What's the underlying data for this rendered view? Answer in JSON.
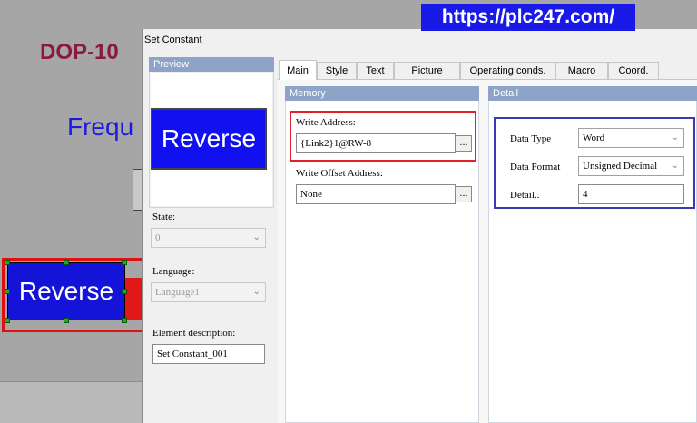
{
  "watermark": {
    "url": "https://plc247.com/"
  },
  "canvas": {
    "title": "DOP-10",
    "frequency_label": "Frequ",
    "button_label": "Reverse"
  },
  "dialog": {
    "title": "Set Constant",
    "preview": {
      "header": "Preview",
      "button_label": "Reverse"
    },
    "state": {
      "label": "State:",
      "value": "0"
    },
    "language": {
      "label": "Language:",
      "value": "Language1"
    },
    "element_description": {
      "label": "Element description:",
      "value": "Set Constant_001"
    },
    "tabs": [
      {
        "label": "Main"
      },
      {
        "label": "Style"
      },
      {
        "label": "Text"
      },
      {
        "label": "Picture"
      },
      {
        "label": "Operating conds."
      },
      {
        "label": "Macro"
      },
      {
        "label": "Coord."
      }
    ],
    "memory": {
      "header": "Memory",
      "write_address_label": "Write Address:",
      "write_address_value": "{Link2}1@RW-8",
      "write_offset_label": "Write Offset Address:",
      "write_offset_value": "None",
      "browse_label": "..."
    },
    "detail": {
      "header": "Detail",
      "data_type_label": "Data Type",
      "data_type_value": "Word",
      "data_format_label": "Data Format",
      "data_format_value": "Unsigned Decimal",
      "detail_label": "Detail..",
      "detail_value": "4"
    }
  },
  "colors": {
    "accent_red": "#e0202a",
    "accent_blue": "#3a3ab0",
    "button_blue": "#1010f0",
    "group_header": "#8ea3c8"
  }
}
